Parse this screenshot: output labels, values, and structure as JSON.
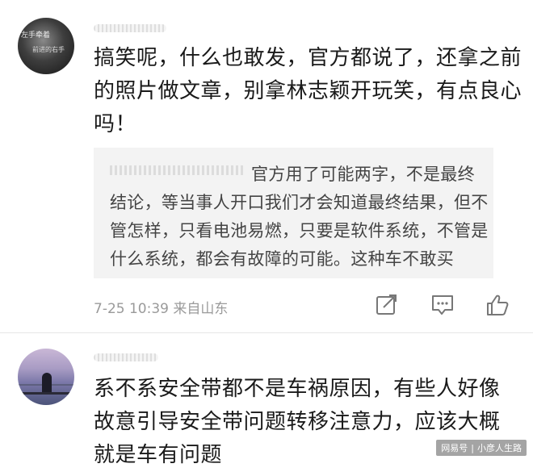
{
  "comments": [
    {
      "avatar_text_line1": "左手牵着",
      "avatar_text_line2": "前进的右手",
      "body": "搞笑呢，什么也敢发，官方都说了，还拿之前的照片做文章，别拿林志颖开玩笑，有点良心吗！",
      "reply_quote": "官方用了可能两字，不是最终结论，等当事人开口我们才会知道最终结果，但不管怎样，只看电池易燃，只要是软件系统，不管是什么系统，都会有故障的可能。这种车不敢买",
      "timestamp": "7-25 10:39",
      "location": "来自山东",
      "icons": [
        "share-icon",
        "comment-icon",
        "like-icon"
      ]
    },
    {
      "body": "系不系安全带都不是车祸原因，有些人好像故意引导安全带问题转移注意力，应该大概就是车有问题"
    }
  ],
  "watermark": {
    "platform": "网易号",
    "separator": "|",
    "author": "小彦人生路"
  }
}
